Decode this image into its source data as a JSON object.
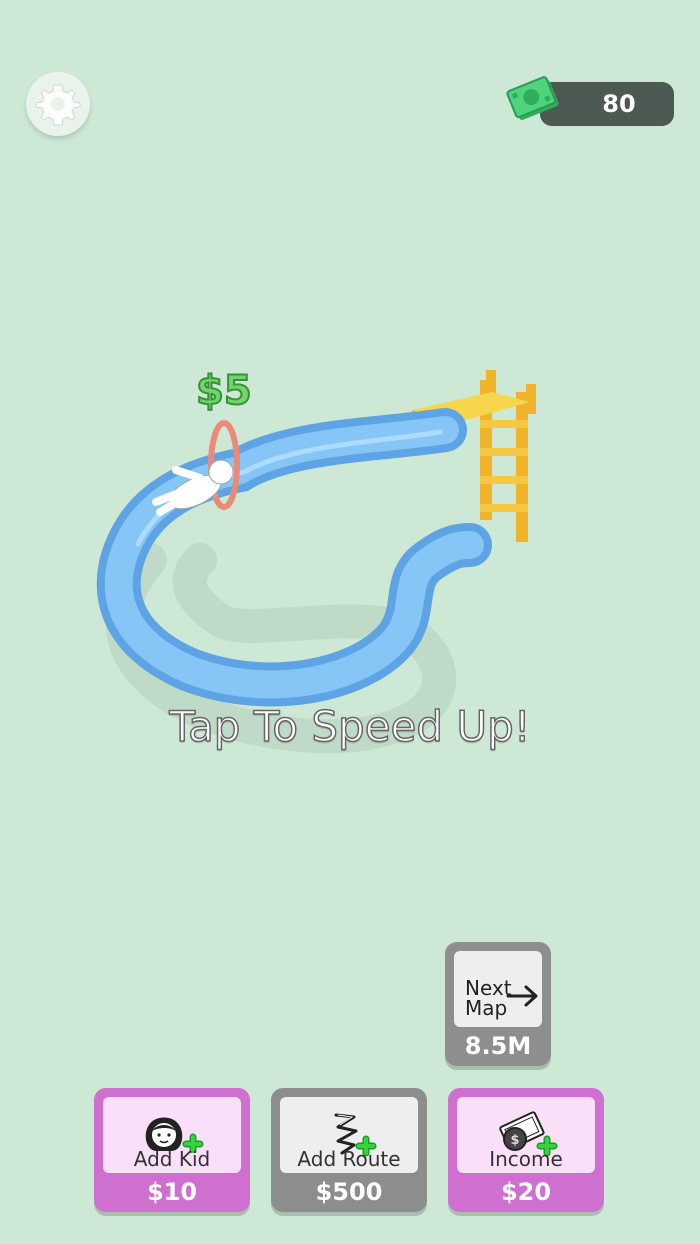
{
  "hud": {
    "money": "80",
    "settings_icon": "gear-icon",
    "cash_icon": "cash-icon"
  },
  "game": {
    "earn_popup": "$5",
    "hint": "Tap To Speed Up!"
  },
  "next_map": {
    "line1": "Next",
    "line2": "Map",
    "price": "8.5M",
    "icon": "arrow-right-icon"
  },
  "upgrades": {
    "add_kid": {
      "label": "Add Kid",
      "price": "$10",
      "icon": "kid-face-icon"
    },
    "add_route": {
      "label": "Add Route",
      "price": "$500",
      "icon": "slide-route-icon"
    },
    "income": {
      "label": "Income",
      "price": "$20",
      "icon": "coin-cash-icon"
    }
  },
  "colors": {
    "background": "#cde9d6",
    "slide": "#6fb4ee",
    "ladder": "#f6c740",
    "pink_button": "#cf6fd0",
    "gray_button": "#8d8d8d",
    "plus": "#2fd13a"
  }
}
